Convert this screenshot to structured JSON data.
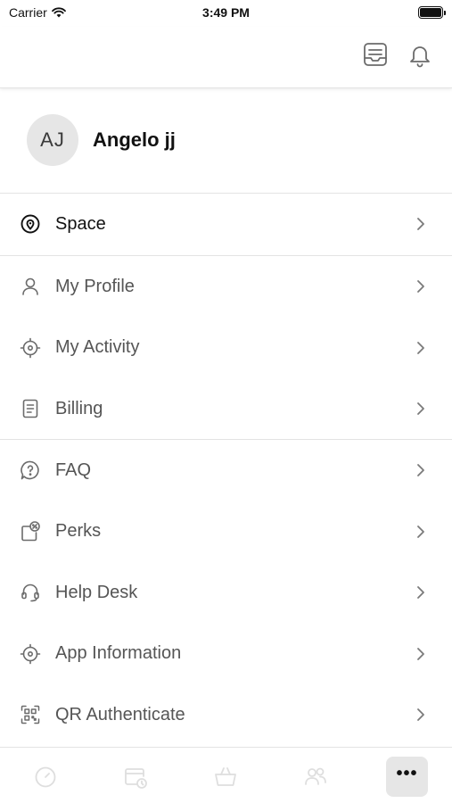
{
  "status_bar": {
    "carrier": "Carrier",
    "time": "3:49 PM"
  },
  "top_nav": {
    "icons": [
      "inbox-icon",
      "bell-icon"
    ]
  },
  "profile": {
    "initials": "AJ",
    "name": "Angelo jj"
  },
  "menu": {
    "space": "Space",
    "my_profile": "My Profile",
    "my_activity": "My Activity",
    "billing": "Billing",
    "faq": "FAQ",
    "perks": "Perks",
    "help_desk": "Help Desk",
    "app_information": "App Information",
    "qr_authenticate": "QR Authenticate"
  },
  "tab_bar": {
    "more_label": "•••"
  },
  "colors": {
    "text_primary": "#111111",
    "text_secondary": "#555555",
    "icon": "#6b6b6b",
    "divider": "#e3e3e3",
    "avatar_bg": "#e6e6e6"
  }
}
